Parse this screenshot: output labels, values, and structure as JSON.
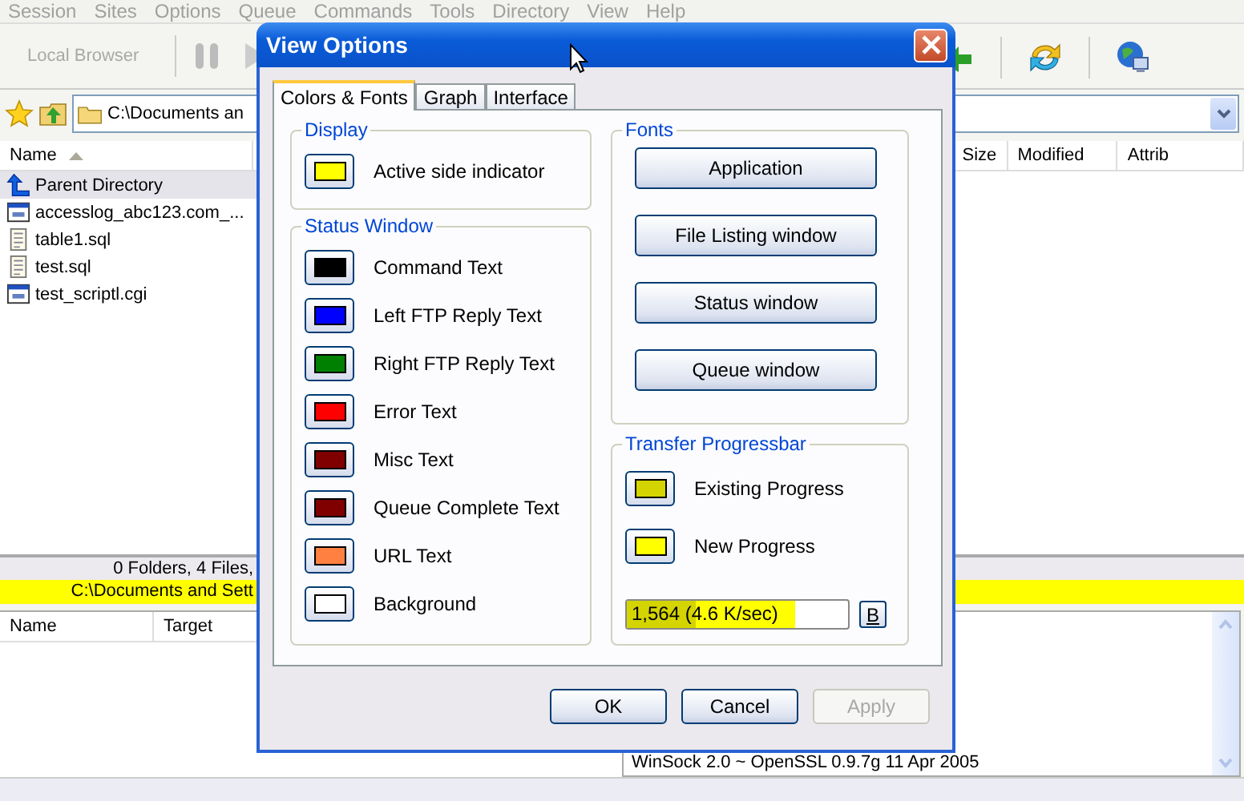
{
  "menu": [
    "Session",
    "Sites",
    "Options",
    "Queue",
    "Commands",
    "Tools",
    "Directory",
    "View",
    "Help"
  ],
  "toolbar": {
    "local_browser": "Local Browser"
  },
  "left_pane": {
    "path": "C:\\Documents an",
    "columns": [
      {
        "label": "Name",
        "sorted": true
      }
    ],
    "files": [
      {
        "name": "Parent Directory",
        "kind": "up",
        "selected": true
      },
      {
        "name": "accesslog_abc123.com_...",
        "kind": "web",
        "selected": false
      },
      {
        "name": "table1.sql",
        "kind": "text",
        "selected": false
      },
      {
        "name": "test.sql",
        "kind": "text",
        "selected": false
      },
      {
        "name": "test_scriptl.cgi",
        "kind": "web",
        "selected": false
      }
    ],
    "status": "0 Folders, 4 Files,",
    "path_status": "C:\\Documents and Sett"
  },
  "right_pane": {
    "columns": [
      "Size",
      "Modified",
      "Attrib"
    ],
    "log": "WinSock 2.0 ~ OpenSSL 0.9.7g 11 Apr 2005"
  },
  "queue": {
    "columns": [
      "Name",
      "Target"
    ]
  },
  "dialog": {
    "title": "View Options",
    "tabs": [
      {
        "label": "Colors & Fonts",
        "selected": true
      },
      {
        "label": "Graph",
        "selected": false
      },
      {
        "label": "Interface",
        "selected": false
      }
    ],
    "display": {
      "title": "Display",
      "items": [
        {
          "label": "Active side indicator",
          "color": "#ffff00"
        }
      ]
    },
    "status_window": {
      "title": "Status Window",
      "items": [
        {
          "label": "Command Text",
          "color": "#000000"
        },
        {
          "label": "Left FTP Reply Text",
          "color": "#0000ff"
        },
        {
          "label": "Right FTP Reply Text",
          "color": "#008000"
        },
        {
          "label": "Error Text",
          "color": "#ff0000"
        },
        {
          "label": "Misc Text",
          "color": "#800000"
        },
        {
          "label": "Queue Complete Text",
          "color": "#800000"
        },
        {
          "label": "URL Text",
          "color": "#ff8040"
        },
        {
          "label": "Background",
          "color": "#ffffff"
        }
      ]
    },
    "fonts": {
      "title": "Fonts",
      "buttons": [
        "Application",
        "File Listing window",
        "Status window",
        "Queue window"
      ]
    },
    "transfer": {
      "title": "Transfer Progressbar",
      "items": [
        {
          "label": "Existing Progress",
          "color": "#d4d400"
        },
        {
          "label": "New Progress",
          "color": "#ffff00"
        }
      ],
      "progress": {
        "text": "1,564 (4.6 K/sec)",
        "existing": {
          "level": 0.31
        },
        "new": {
          "level": 0.76
        }
      },
      "button": "B"
    },
    "buttons": [
      {
        "label": "OK",
        "disabled": false
      },
      {
        "label": "Cancel",
        "disabled": false
      },
      {
        "label": "Apply",
        "disabled": true
      }
    ]
  }
}
